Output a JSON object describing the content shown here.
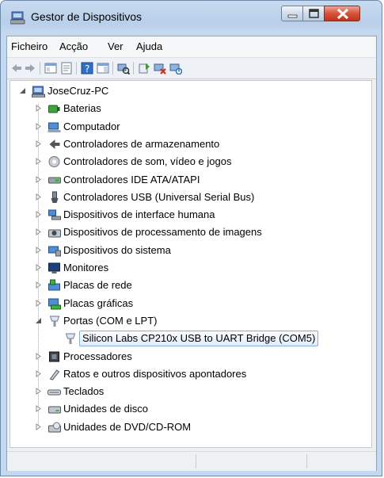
{
  "window": {
    "title": "Gestor de Dispositivos"
  },
  "menu": [
    "Ficheiro",
    "Acção",
    "Ver",
    "Ajuda"
  ],
  "toolbar_icons": [
    "back-arrow-icon",
    "forward-arrow-icon",
    "show-hide-tree-icon",
    "properties-icon",
    "help-icon",
    "action-pane-icon",
    "scan-hardware-icon",
    "update-driver-icon",
    "uninstall-icon",
    "disable-icon"
  ],
  "tree": {
    "root": "JoseCruz-PC",
    "categories": [
      "Baterias",
      "Computador",
      "Controladores de armazenamento",
      "Controladores de som, vídeo e jogos",
      "Controladores IDE ATA/ATAPI",
      "Controladores USB (Universal Serial Bus)",
      "Dispositivos de interface humana",
      "Dispositivos de processamento de imagens",
      "Dispositivos do sistema",
      "Monitores",
      "Placas de rede",
      "Placas gráficas",
      "Portas (COM e LPT)",
      "Processadores",
      "Ratos e outros dispositivos apontadores",
      "Teclados",
      "Unidades de disco",
      "Unidades de DVD/CD-ROM"
    ],
    "ports_child": "Silicon Labs CP210x USB to UART Bridge (COM5)"
  },
  "colors": {
    "selection_border": "#84acdd",
    "close_button": "#c2331c",
    "title_bar": "#b9cfe9"
  }
}
